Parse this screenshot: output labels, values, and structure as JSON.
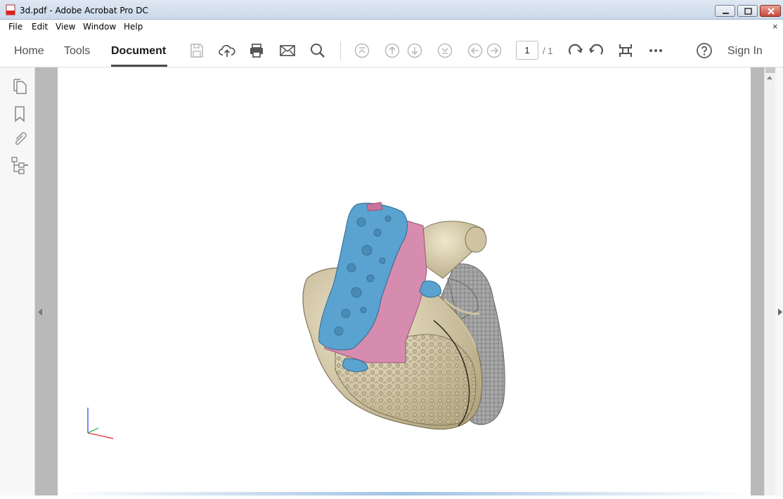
{
  "window": {
    "title": "3d.pdf - Adobe Acrobat Pro DC"
  },
  "menubar": {
    "items": [
      "File",
      "Edit",
      "View",
      "Window",
      "Help"
    ],
    "close_glyph": "×"
  },
  "toolbar": {
    "tabs": [
      "Home",
      "Tools",
      "Document"
    ],
    "active_tab": "Document",
    "page_current": "1",
    "page_total": "/ 1",
    "sign_in": "Sign In",
    "icons": [
      "save-icon",
      "upload-icon",
      "print-icon",
      "email-icon",
      "search-icon",
      "first-page-icon",
      "previous-page-icon",
      "next-page-icon",
      "last-page-icon",
      "back-icon",
      "forward-icon",
      "rotate-clockwise-icon",
      "rotate-counterclockwise-icon",
      "read-mode-icon",
      "more-icon",
      "help-icon"
    ]
  },
  "left_panel": {
    "icons": [
      "page-thumbnails-icon",
      "bookmarks-icon",
      "attachments-icon",
      "model-tree-icon"
    ]
  },
  "document": {
    "content": "3D model of a heart rendered in the page",
    "colors": {
      "tissue": "#d8ccaa",
      "vessel_blue": "#5a9fc9",
      "vessel_pink": "#d07ea3",
      "grey_tissue": "#9a9a9a"
    }
  }
}
